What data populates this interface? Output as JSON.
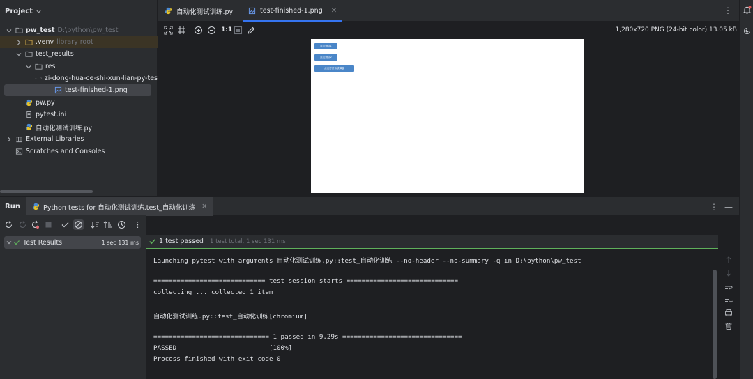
{
  "project": {
    "header": "Project",
    "tree": [
      {
        "label": "pw_test",
        "hint": "D:\\python\\pw_test",
        "bold": true
      },
      {
        "label": ".venv",
        "hint": "library root"
      },
      {
        "label": "test_results"
      },
      {
        "label": "res"
      },
      {
        "label": "zi-dong-hua-ce-shi-xun-lian-py-tes"
      },
      {
        "label": "test-finished-1.png"
      },
      {
        "label": "pw.py"
      },
      {
        "label": "pytest.ini"
      },
      {
        "label": "自动化测试训练.py"
      },
      {
        "label": "External Libraries"
      },
      {
        "label": "Scratches and Consoles"
      }
    ]
  },
  "editor": {
    "tabs": [
      {
        "label": "自动化测试训练.py"
      },
      {
        "label": "test-finished-1.png"
      }
    ],
    "toolbar": {
      "zoom": "1:1",
      "image_info": "1,280x720 PNG (24-bit color) 13.05 kB"
    },
    "preview_buttons": [
      "点击测试1",
      "点击测试2",
      "点击打开系统弹窗"
    ]
  },
  "run": {
    "title": "Run",
    "tab_label": "Python tests for 自动化测试训练.test_自动化训练",
    "tree": {
      "label": "Test Results",
      "time": "1 sec 131 ms"
    },
    "status": {
      "passed": "1 test passed",
      "total": "1 test total, 1 sec 131 ms"
    },
    "console": [
      "Launching pytest with arguments 自动化测试训练.py::test_自动化训练 --no-header --no-summary -q in D:\\python\\pw_test",
      "",
      "============================= test session starts =============================",
      "collecting ... collected 1 item",
      "",
      "自动化测试训练.py::test_自动化训练[chromium]",
      "",
      "============================== 1 passed in 9.29s ===============================",
      "PASSED                        [100%]",
      "Process finished with exit code 0"
    ]
  },
  "colors": {
    "accent": "#3574f0",
    "success": "#5fb05b",
    "panel": "#2b2d30",
    "editor_bg": "#1e1f22"
  }
}
